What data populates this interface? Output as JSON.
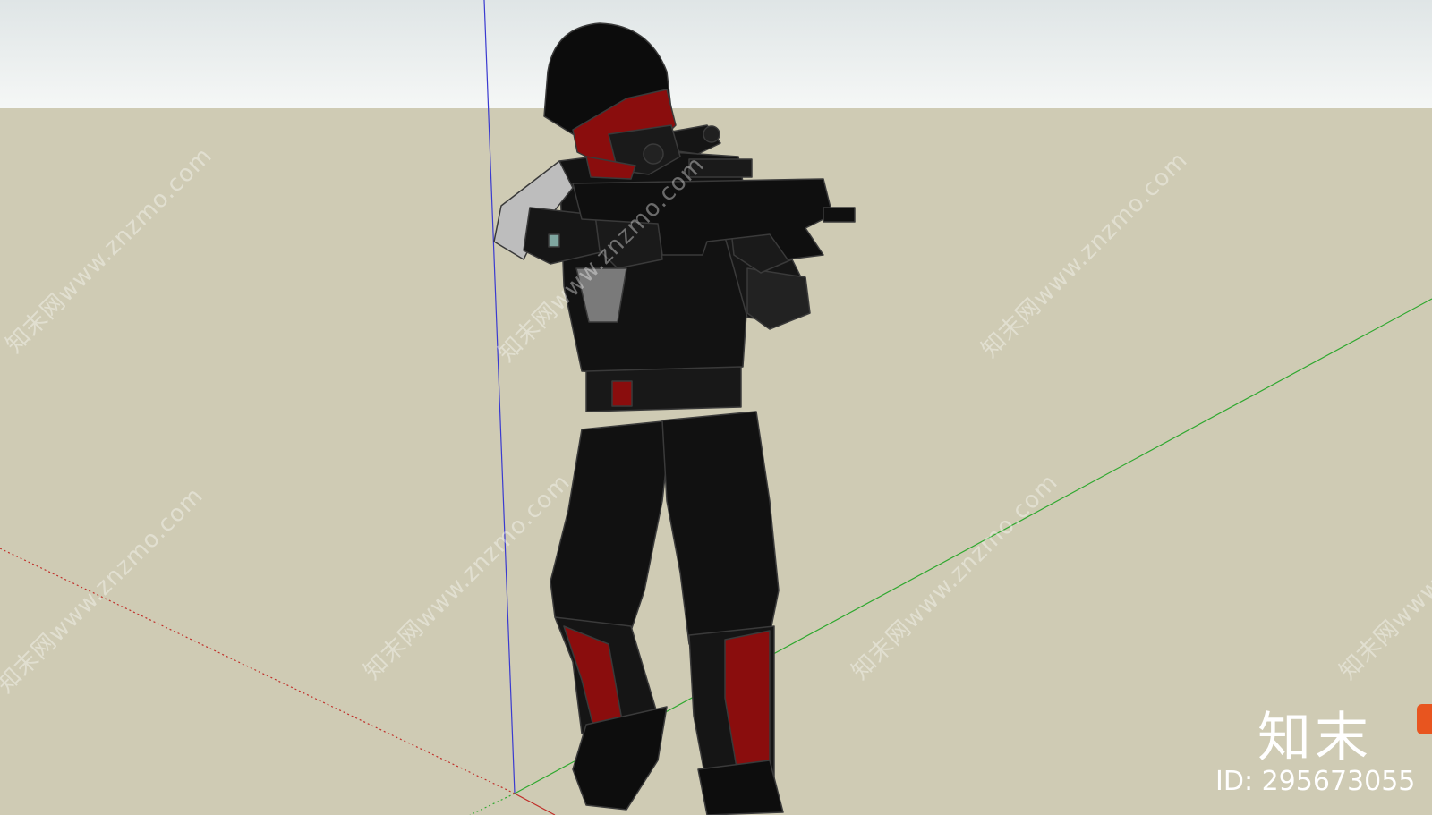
{
  "viewport": {
    "sky_top_color": "#e8ecec",
    "sky_horizon_color": "#f4f6f5",
    "ground_color": "#cfcbb4",
    "axes": {
      "red_axis_color": "#c0302a",
      "green_axis_color": "#2fa82f",
      "blue_axis_color": "#3a3ad0"
    }
  },
  "model": {
    "armor_color": "#111111",
    "accent_color": "#8a0d0d",
    "highlight_color": "#c4c4c4"
  },
  "watermark": {
    "site_text": "知末网www.znzmo.com",
    "logo_text": "知末",
    "id_text": "ID: 295673055",
    "brand_color": "#e8551f"
  }
}
